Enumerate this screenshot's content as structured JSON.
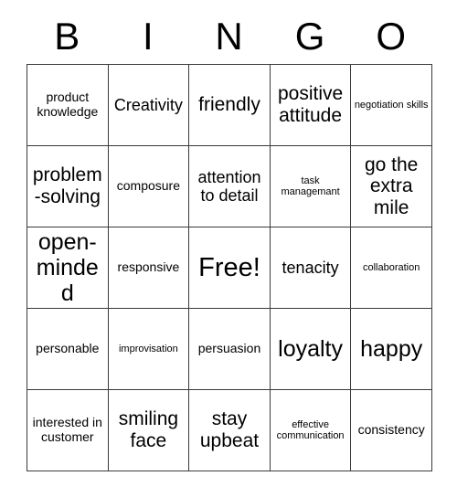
{
  "card": {
    "header_letters": [
      "B",
      "I",
      "N",
      "G",
      "O"
    ],
    "rows": [
      [
        {
          "text": "product knowledge",
          "size": "fs-sm"
        },
        {
          "text": "Creativity",
          "size": "fs-md"
        },
        {
          "text": "friendly",
          "size": "fs-lg"
        },
        {
          "text": "positive attitude",
          "size": "fs-lg"
        },
        {
          "text": "negotiation skills",
          "size": "fs-xs"
        }
      ],
      [
        {
          "text": "problem-solving",
          "size": "fs-lg"
        },
        {
          "text": "composure",
          "size": "fs-sm"
        },
        {
          "text": "attention to detail",
          "size": "fs-md"
        },
        {
          "text": "task managemant",
          "size": "fs-xs"
        },
        {
          "text": "go the extra mile",
          "size": "fs-lg"
        }
      ],
      [
        {
          "text": "open-minded",
          "size": "fs-xl"
        },
        {
          "text": "responsive",
          "size": "fs-sm"
        },
        {
          "text": "Free!",
          "size": "fs-free"
        },
        {
          "text": "tenacity",
          "size": "fs-md"
        },
        {
          "text": "collaboration",
          "size": "fs-xs"
        }
      ],
      [
        {
          "text": "personable",
          "size": "fs-sm"
        },
        {
          "text": "improvisation",
          "size": "fs-xs"
        },
        {
          "text": "persuasion",
          "size": "fs-sm"
        },
        {
          "text": "loyalty",
          "size": "fs-xl"
        },
        {
          "text": "happy",
          "size": "fs-xl"
        }
      ],
      [
        {
          "text": "interested in customer",
          "size": "fs-sm"
        },
        {
          "text": "smiling face",
          "size": "fs-lg"
        },
        {
          "text": "stay upbeat",
          "size": "fs-lg"
        },
        {
          "text": "effective communication",
          "size": "fs-xs"
        },
        {
          "text": "consistency",
          "size": "fs-sm"
        }
      ]
    ]
  }
}
